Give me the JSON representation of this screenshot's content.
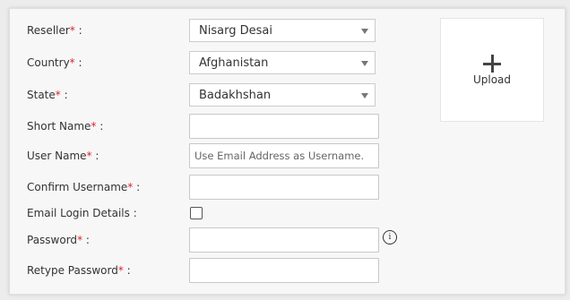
{
  "form": {
    "reseller": {
      "label": "Reseller",
      "req": "*",
      "colon": " :",
      "value": "Nisarg Desai"
    },
    "country": {
      "label": "Country",
      "req": "*",
      "colon": " :",
      "value": "Afghanistan"
    },
    "state": {
      "label": "State",
      "req": "*",
      "colon": " :",
      "value": "Badakhshan"
    },
    "short_name": {
      "label": "Short Name",
      "req": "*",
      "colon": " :",
      "value": ""
    },
    "user_name": {
      "label": "User Name",
      "req": "*",
      "colon": " :",
      "placeholder": "Use Email Address as Username."
    },
    "confirm_username": {
      "label": "Confirm Username",
      "req": "*",
      "colon": " :",
      "value": ""
    },
    "email_login": {
      "label": "Email Login Details :",
      "checked": false
    },
    "password": {
      "label": "Password",
      "req": "*",
      "colon": " :",
      "info_icon": "info-icon",
      "info_glyph": "i"
    },
    "retype_password": {
      "label": "Retype Password",
      "req": "*",
      "colon": " :"
    }
  },
  "upload": {
    "label": "Upload",
    "icon": "plus-icon"
  }
}
